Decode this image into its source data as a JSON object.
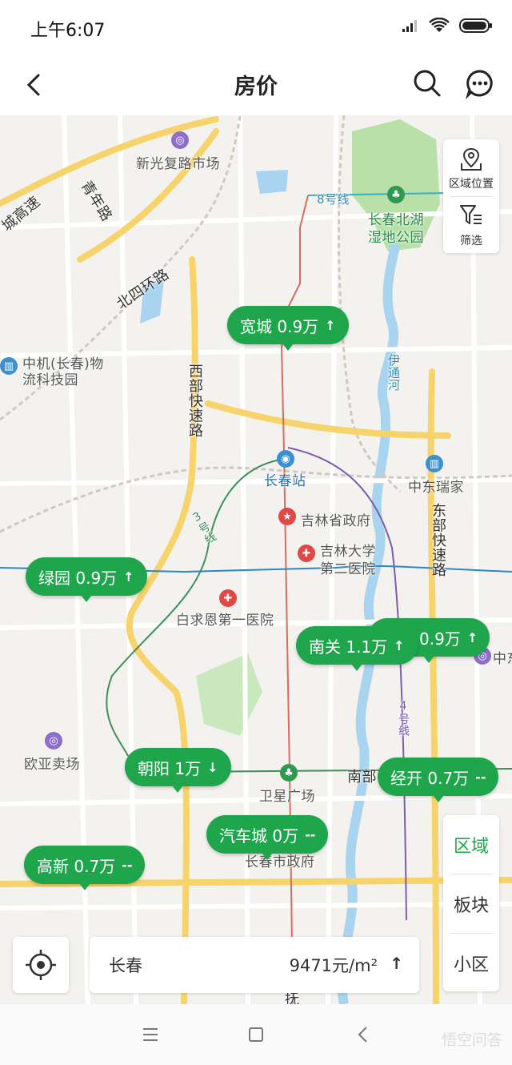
{
  "status_bar": {
    "time": "上午6:07"
  },
  "header": {
    "title": "房价"
  },
  "icons": {
    "back": "back-arrow-icon",
    "search": "search-icon",
    "chat": "chat-bubble-icon",
    "area_location": "map-pin-icon",
    "filter": "filter-icon",
    "locate": "locate-icon"
  },
  "side_tools": {
    "area_location": "区域位置",
    "filter": "筛选"
  },
  "level_tabs": [
    {
      "label": "区域",
      "active": true
    },
    {
      "label": "板块",
      "active": false
    },
    {
      "label": "小区",
      "active": false
    }
  ],
  "city_card": {
    "city": "长春",
    "price": "9471元/m²",
    "trend": "↑"
  },
  "bubbles": [
    {
      "name": "宽城",
      "price": "0.9万",
      "trend": "↑"
    },
    {
      "name": "绿园",
      "price": "0.9万",
      "trend": "↑"
    },
    {
      "name": "",
      "price": "0.9万",
      "trend": "↑"
    },
    {
      "name": "南关",
      "price": "1.1万",
      "trend": "↑"
    },
    {
      "name": "朝阳",
      "price": "1万",
      "trend": "↓"
    },
    {
      "name": "经开",
      "price": "0.7万",
      "trend": "--"
    },
    {
      "name": "汽车城",
      "price": "0万",
      "trend": "--"
    },
    {
      "name": "高新",
      "price": "0.7万",
      "trend": "--"
    }
  ],
  "map_labels": {
    "xinguangfu": "新光复路市场",
    "qingnian_rd": "青年路",
    "city_expressway": "城高速",
    "line8": "8号线",
    "north_lake": "长春北湖",
    "north_lake2": "湿地公园",
    "beisihuan": "北四环路",
    "zhongji": "中机(长春)物",
    "zhongji2": "流科技园",
    "xibu_expressway": "西部快速路",
    "yitong_river": "伊通河",
    "changchun_station": "长春站",
    "zhongdong": "中东瑞家",
    "jilin_gov": "吉林省政府",
    "dongbu_expressway": "东部快速路",
    "jilin_univ": "吉林大学",
    "jilin_univ2": "第二医院",
    "line3": "3号线",
    "bethune": "白求恩第一医院",
    "zhong_partial": "中东",
    "line4": "4号线",
    "ouya": "欧亚卖场",
    "weixing": "卫星广场",
    "nanbu": "南部",
    "changchun_gov": "长春市政府",
    "road_bottom": "抚"
  },
  "nav_bar": {
    "watermark": "悟空问答"
  },
  "colors": {
    "accent": "#1fa64c",
    "road_major": "#f7d36b",
    "park": "#b8e0a8",
    "water": "#a8d4ef"
  }
}
